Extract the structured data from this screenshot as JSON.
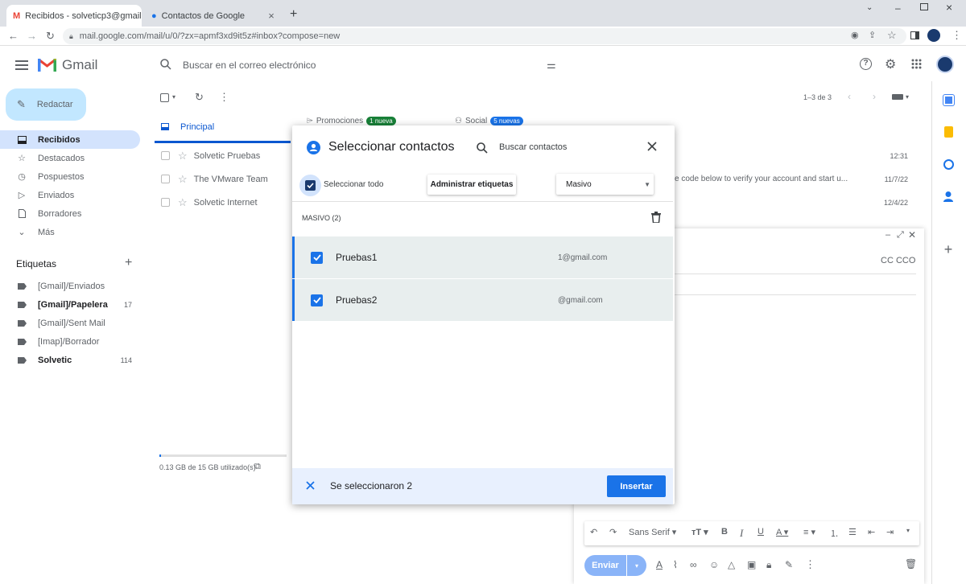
{
  "browser": {
    "tabs": [
      {
        "label": "Recibidos - solveticp3@gmail.co"
      },
      {
        "label": "Contactos de Google"
      }
    ],
    "url": "mail.google.com/mail/u/0/?zx=apmf3xd9it5z#inbox?compose=new"
  },
  "gmail": {
    "logo_text": "Gmail",
    "search_placeholder": "Buscar en el correo electrónico",
    "compose_label": "Redactar",
    "nav": [
      {
        "label": "Recibidos",
        "icon": "inbox-icon"
      },
      {
        "label": "Destacados",
        "icon": "star-icon"
      },
      {
        "label": "Pospuestos",
        "icon": "clock-icon"
      },
      {
        "label": "Enviados",
        "icon": "send-icon"
      },
      {
        "label": "Borradores",
        "icon": "draft-icon"
      },
      {
        "label": "Más",
        "icon": "chevron-down-icon"
      }
    ],
    "labels_heading": "Etiquetas",
    "labels": [
      {
        "label": "[Gmail]/Enviados",
        "count": ""
      },
      {
        "label": "[Gmail]/Papelera",
        "count": "17"
      },
      {
        "label": "[Gmail]/Sent Mail",
        "count": ""
      },
      {
        "label": "[Imap]/Borrador",
        "count": ""
      },
      {
        "label": "Solvetic",
        "count": "114"
      }
    ],
    "storage": "0.13 GB de 15 GB utilizado(s)",
    "pagination": "1–3 de 3",
    "tabs": [
      {
        "label": "Principal"
      },
      {
        "label": "Promociones",
        "badge": "1 nueva"
      },
      {
        "label": "Social",
        "badge": "5 nuevas"
      }
    ],
    "emails": [
      {
        "sender": "Solvetic Pruebas",
        "snippet": "",
        "date": "12:31"
      },
      {
        "sender": "The VMware Team",
        "snippet": "e code below to verify your account and start u...",
        "date": "11/7/22"
      },
      {
        "sender": "Solvetic Internet",
        "snippet": "",
        "date": "12/4/22"
      }
    ]
  },
  "dialog": {
    "title": "Seleccionar contactos",
    "search_placeholder": "Buscar contactos",
    "select_all_label": "Seleccionar todo",
    "manage_labels_button": "Administrar etiquetas",
    "label_select_value": "Masivo",
    "group_header": "MASIVO (2)",
    "contacts": [
      {
        "name": "Pruebas1",
        "email": "1@gmail.com",
        "checked": true
      },
      {
        "name": "Pruebas2",
        "email": "@gmail.com",
        "checked": true
      }
    ],
    "selected_text": "Se seleccionaron 2",
    "insert_button": "Insertar"
  },
  "compose": {
    "cc_label": "CC CCO",
    "font_name": "Sans Serif",
    "send_button": "Enviar"
  },
  "colors": {
    "accent": "#1a73e8",
    "selected_nav": "#d3e3fd",
    "dialog_footer": "#e8f0fe",
    "badge_green": "#188038",
    "badge_blue": "#1a73e8"
  }
}
